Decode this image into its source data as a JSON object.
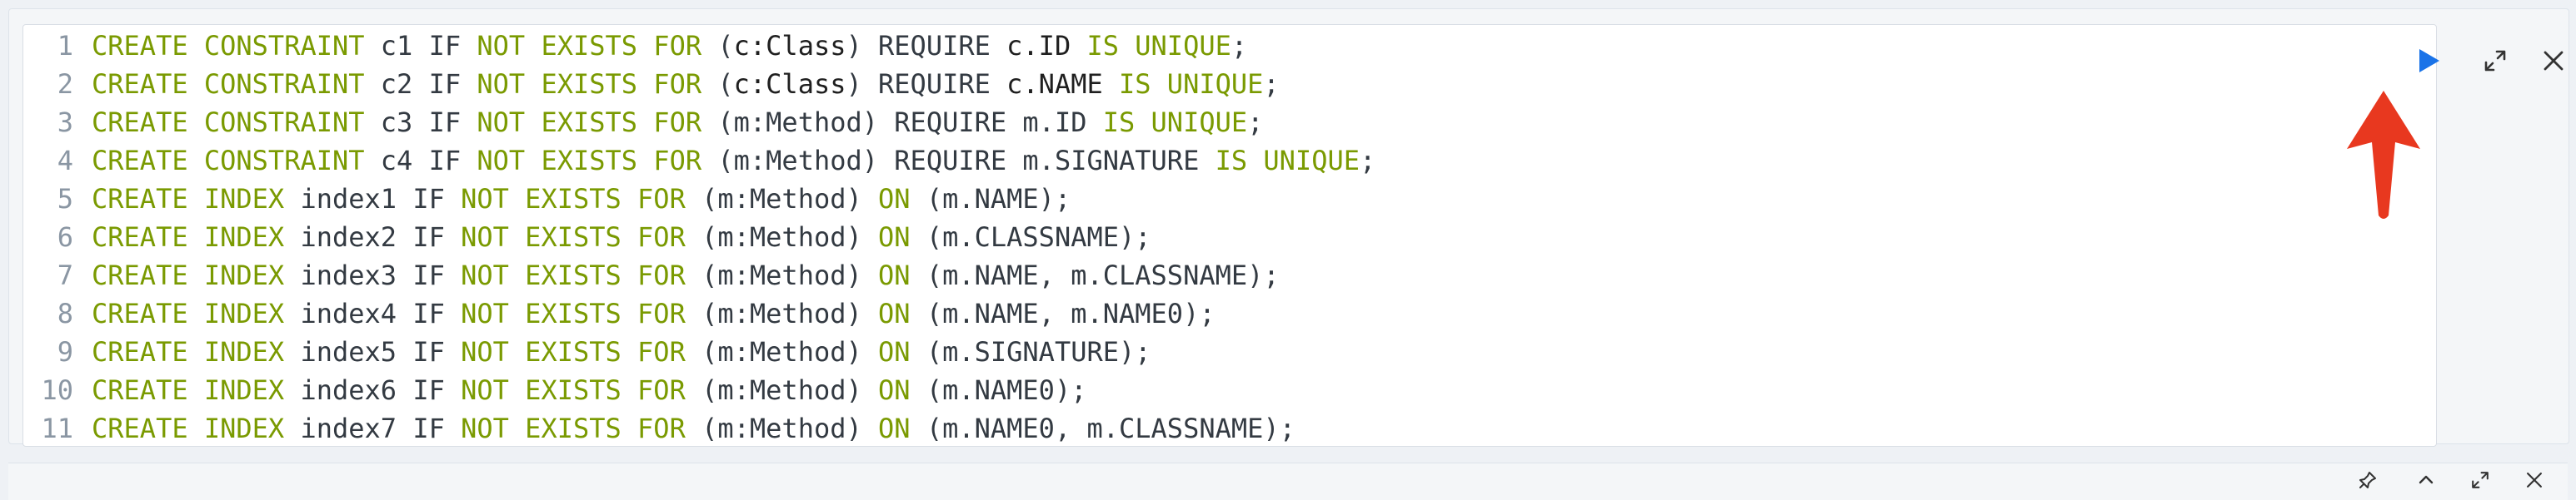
{
  "editor": {
    "lines": [
      {
        "num": "1",
        "tokens": [
          {
            "t": "CREATE",
            "c": "kw"
          },
          {
            "t": " "
          },
          {
            "t": "CONSTRAINT",
            "c": "kw"
          },
          {
            "t": " c1 IF "
          },
          {
            "t": "NOT",
            "c": "kw"
          },
          {
            "t": " "
          },
          {
            "t": "EXISTS",
            "c": "kw"
          },
          {
            "t": " "
          },
          {
            "t": "FOR",
            "c": "kw"
          },
          {
            "t": " ("
          },
          {
            "t": "c:Class",
            "c": "ident"
          },
          {
            "t": ") REQUIRE "
          },
          {
            "t": "c.ID",
            "c": "ident"
          },
          {
            "t": " "
          },
          {
            "t": "IS",
            "c": "kw"
          },
          {
            "t": " "
          },
          {
            "t": "UNIQUE",
            "c": "kw"
          },
          {
            "t": ";"
          }
        ]
      },
      {
        "num": "2",
        "tokens": [
          {
            "t": "CREATE",
            "c": "kw"
          },
          {
            "t": " "
          },
          {
            "t": "CONSTRAINT",
            "c": "kw"
          },
          {
            "t": " c2 IF "
          },
          {
            "t": "NOT",
            "c": "kw"
          },
          {
            "t": " "
          },
          {
            "t": "EXISTS",
            "c": "kw"
          },
          {
            "t": " "
          },
          {
            "t": "FOR",
            "c": "kw"
          },
          {
            "t": " ("
          },
          {
            "t": "c:Class",
            "c": "ident"
          },
          {
            "t": ") REQUIRE "
          },
          {
            "t": "c.NAME",
            "c": "ident"
          },
          {
            "t": " "
          },
          {
            "t": "IS",
            "c": "kw"
          },
          {
            "t": " "
          },
          {
            "t": "UNIQUE",
            "c": "kw"
          },
          {
            "t": ";"
          }
        ]
      },
      {
        "num": "3",
        "tokens": [
          {
            "t": "CREATE",
            "c": "kw"
          },
          {
            "t": " "
          },
          {
            "t": "CONSTRAINT",
            "c": "kw"
          },
          {
            "t": " c3 IF "
          },
          {
            "t": "NOT",
            "c": "kw"
          },
          {
            "t": " "
          },
          {
            "t": "EXISTS",
            "c": "kw"
          },
          {
            "t": " "
          },
          {
            "t": "FOR",
            "c": "kw"
          },
          {
            "t": " (m:Method) REQUIRE m.ID "
          },
          {
            "t": "IS",
            "c": "kw"
          },
          {
            "t": " "
          },
          {
            "t": "UNIQUE",
            "c": "kw"
          },
          {
            "t": ";"
          }
        ]
      },
      {
        "num": "4",
        "tokens": [
          {
            "t": "CREATE",
            "c": "kw"
          },
          {
            "t": " "
          },
          {
            "t": "CONSTRAINT",
            "c": "kw"
          },
          {
            "t": " c4 IF "
          },
          {
            "t": "NOT",
            "c": "kw"
          },
          {
            "t": " "
          },
          {
            "t": "EXISTS",
            "c": "kw"
          },
          {
            "t": " "
          },
          {
            "t": "FOR",
            "c": "kw"
          },
          {
            "t": " (m:Method) REQUIRE m.SIGNATURE "
          },
          {
            "t": "IS",
            "c": "kw"
          },
          {
            "t": " "
          },
          {
            "t": "UNIQUE",
            "c": "kw"
          },
          {
            "t": ";"
          }
        ]
      },
      {
        "num": "5",
        "tokens": [
          {
            "t": "CREATE",
            "c": "kw"
          },
          {
            "t": " "
          },
          {
            "t": "INDEX",
            "c": "kw"
          },
          {
            "t": " index1 IF "
          },
          {
            "t": "NOT",
            "c": "kw"
          },
          {
            "t": " "
          },
          {
            "t": "EXISTS",
            "c": "kw"
          },
          {
            "t": " "
          },
          {
            "t": "FOR",
            "c": "kw"
          },
          {
            "t": " (m:Method) "
          },
          {
            "t": "ON",
            "c": "kw"
          },
          {
            "t": " (m.NAME);"
          }
        ]
      },
      {
        "num": "6",
        "tokens": [
          {
            "t": "CREATE",
            "c": "kw"
          },
          {
            "t": " "
          },
          {
            "t": "INDEX",
            "c": "kw"
          },
          {
            "t": " index2 IF "
          },
          {
            "t": "NOT",
            "c": "kw"
          },
          {
            "t": " "
          },
          {
            "t": "EXISTS",
            "c": "kw"
          },
          {
            "t": " "
          },
          {
            "t": "FOR",
            "c": "kw"
          },
          {
            "t": " (m:Method) "
          },
          {
            "t": "ON",
            "c": "kw"
          },
          {
            "t": " (m.CLASSNAME);"
          }
        ]
      },
      {
        "num": "7",
        "tokens": [
          {
            "t": "CREATE",
            "c": "kw"
          },
          {
            "t": " "
          },
          {
            "t": "INDEX",
            "c": "kw"
          },
          {
            "t": " index3 IF "
          },
          {
            "t": "NOT",
            "c": "kw"
          },
          {
            "t": " "
          },
          {
            "t": "EXISTS",
            "c": "kw"
          },
          {
            "t": " "
          },
          {
            "t": "FOR",
            "c": "kw"
          },
          {
            "t": " (m:Method) "
          },
          {
            "t": "ON",
            "c": "kw"
          },
          {
            "t": " (m.NAME, m.CLASSNAME);"
          }
        ]
      },
      {
        "num": "8",
        "tokens": [
          {
            "t": "CREATE",
            "c": "kw"
          },
          {
            "t": " "
          },
          {
            "t": "INDEX",
            "c": "kw"
          },
          {
            "t": " index4 IF "
          },
          {
            "t": "NOT",
            "c": "kw"
          },
          {
            "t": " "
          },
          {
            "t": "EXISTS",
            "c": "kw"
          },
          {
            "t": " "
          },
          {
            "t": "FOR",
            "c": "kw"
          },
          {
            "t": " (m:Method) "
          },
          {
            "t": "ON",
            "c": "kw"
          },
          {
            "t": " (m.NAME, m.NAME0);"
          }
        ]
      },
      {
        "num": "9",
        "tokens": [
          {
            "t": "CREATE",
            "c": "kw"
          },
          {
            "t": " "
          },
          {
            "t": "INDEX",
            "c": "kw"
          },
          {
            "t": " index5 IF "
          },
          {
            "t": "NOT",
            "c": "kw"
          },
          {
            "t": " "
          },
          {
            "t": "EXISTS",
            "c": "kw"
          },
          {
            "t": " "
          },
          {
            "t": "FOR",
            "c": "kw"
          },
          {
            "t": " (m:Method) "
          },
          {
            "t": "ON",
            "c": "kw"
          },
          {
            "t": " (m.SIGNATURE);"
          }
        ]
      },
      {
        "num": "10",
        "tokens": [
          {
            "t": "CREATE",
            "c": "kw"
          },
          {
            "t": " "
          },
          {
            "t": "INDEX",
            "c": "kw"
          },
          {
            "t": " index6 IF "
          },
          {
            "t": "NOT",
            "c": "kw"
          },
          {
            "t": " "
          },
          {
            "t": "EXISTS",
            "c": "kw"
          },
          {
            "t": " "
          },
          {
            "t": "FOR",
            "c": "kw"
          },
          {
            "t": " (m:Method) "
          },
          {
            "t": "ON",
            "c": "kw"
          },
          {
            "t": " (m.NAME0);"
          }
        ]
      },
      {
        "num": "11",
        "tokens": [
          {
            "t": "CREATE",
            "c": "kw"
          },
          {
            "t": " "
          },
          {
            "t": "INDEX",
            "c": "kw"
          },
          {
            "t": " index7 IF "
          },
          {
            "t": "NOT",
            "c": "kw"
          },
          {
            "t": " "
          },
          {
            "t": "EXISTS",
            "c": "kw"
          },
          {
            "t": " "
          },
          {
            "t": "FOR",
            "c": "kw"
          },
          {
            "t": " (m:Method) "
          },
          {
            "t": "ON",
            "c": "kw"
          },
          {
            "t": " (m.NAME0, m.CLASSNAME);"
          }
        ]
      }
    ]
  },
  "toolbar": {
    "run_icon": "play-icon",
    "expand_icon": "expand-icon",
    "close_icon": "close-icon"
  },
  "bottom_bar": {
    "icons": [
      "pin-icon",
      "chevron-up-icon",
      "expand-icon",
      "close-icon"
    ]
  },
  "colors": {
    "keyword": "#7a9a01",
    "text": "#333a42",
    "line_number": "#8a96a3",
    "run_button": "#1a73e8",
    "annotation_arrow": "#e8381f"
  }
}
